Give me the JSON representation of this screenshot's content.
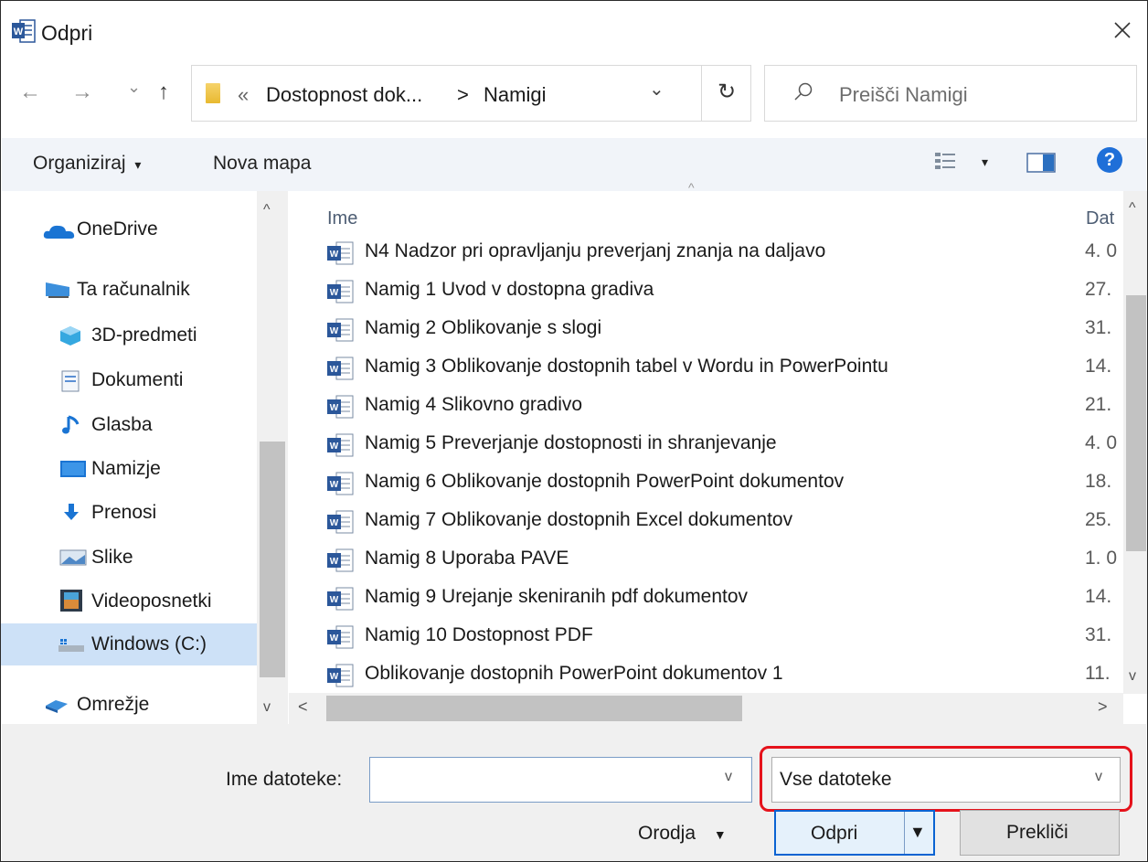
{
  "window": {
    "title": "Odpri",
    "close_icon": "close-icon",
    "app_icon": "word-icon"
  },
  "nav": {
    "back_icon": "←",
    "forward_icon": "→",
    "recent_icon": "⌄",
    "up_icon": "↑",
    "address": {
      "overflow": "«",
      "parent": "Dostopnost dok...",
      "separator": ">",
      "current": "Namigi",
      "dropdown": "⌄"
    },
    "refresh_icon": "↻",
    "search_placeholder": "Preišči Namigi"
  },
  "toolbar": {
    "organize": "Organiziraj",
    "organize_caret": "▾",
    "new_folder": "Nova mapa",
    "view_caret": "▾",
    "help": "?"
  },
  "sidebar": {
    "items": [
      {
        "label": "OneDrive",
        "icon": "cloud-icon"
      },
      {
        "label": "Ta računalnik",
        "icon": "computer-icon"
      },
      {
        "label": "3D-predmeti",
        "icon": "cube-icon"
      },
      {
        "label": "Dokumenti",
        "icon": "document-icon"
      },
      {
        "label": "Glasba",
        "icon": "music-icon"
      },
      {
        "label": "Namizje",
        "icon": "desktop-icon"
      },
      {
        "label": "Prenosi",
        "icon": "download-icon"
      },
      {
        "label": "Slike",
        "icon": "pictures-icon"
      },
      {
        "label": "Videoposnetki",
        "icon": "video-icon"
      },
      {
        "label": "Windows (C:)",
        "icon": "drive-icon",
        "selected": true
      },
      {
        "label": "Omrežje",
        "icon": "network-icon"
      }
    ]
  },
  "files": {
    "column_name": "Ime",
    "column_date": "Dat",
    "rows": [
      {
        "name": "N4 Nadzor pri opravljanju preverjanj znanja na daljavo",
        "date": "4. 0"
      },
      {
        "name": "Namig 1 Uvod v dostopna gradiva",
        "date": "27."
      },
      {
        "name": "Namig 2 Oblikovanje s slogi",
        "date": "31."
      },
      {
        "name": "Namig 3 Oblikovanje dostopnih tabel v Wordu in PowerPointu",
        "date": "14."
      },
      {
        "name": "Namig 4 Slikovno gradivo",
        "date": "21."
      },
      {
        "name": "Namig 5 Preverjanje dostopnosti in shranjevanje",
        "date": "4. 0"
      },
      {
        "name": "Namig 6 Oblikovanje dostopnih PowerPoint dokumentov",
        "date": "18."
      },
      {
        "name": "Namig 7 Oblikovanje dostopnih Excel dokumentov",
        "date": "25."
      },
      {
        "name": "Namig 8 Uporaba PAVE",
        "date": "1. 0"
      },
      {
        "name": "Namig 9 Urejanje skeniranih pdf dokumentov",
        "date": "14."
      },
      {
        "name": "Namig 10 Dostopnost PDF",
        "date": "31."
      },
      {
        "name": "Oblikovanje dostopnih PowerPoint dokumentov 1",
        "date": "11."
      }
    ]
  },
  "bottom": {
    "filename_label": "Ime datoteke:",
    "filename_value": "",
    "filter_value": "Vse datoteke",
    "tools": "Orodja",
    "tools_caret": "▼",
    "open": "Odpri",
    "open_caret": "▼",
    "cancel": "Prekliči",
    "highlight_color": "#e5121b"
  }
}
